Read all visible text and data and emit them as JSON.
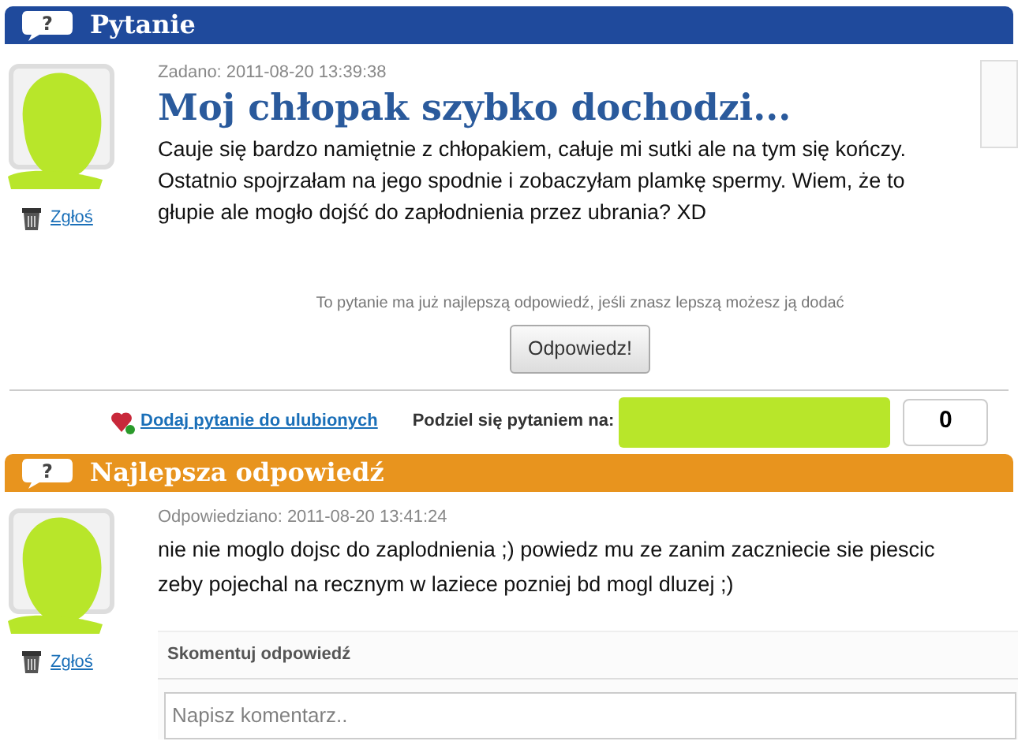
{
  "question": {
    "header_icon": "?",
    "header": "Pytanie",
    "asked": "Zadano: 2011-08-20 13:39:38",
    "title": "Moj chłopak szybko dochodzi...",
    "body": "Cauje się bardzo namiętnie z chłopakiem, całuje mi sutki ale na tym się kończy. Ostatnio spojrzałam na jego spodnie i zobaczyłam plamkę spermy. Wiem, że to głupie ale mogło dojść do zapłodnienia przez ubrania? XD",
    "report": "Zgłoś"
  },
  "notice": "To pytanie ma już najlepszą odpowiedź, jeśli znasz lepszą możesz ją dodać",
  "answer_button": "Odpowiedz!",
  "favorite_link": "Dodaj pytanie do ulubionych",
  "share_label": "Podziel się pytaniem na:",
  "share_count": "0",
  "best_answer": {
    "header_icon": "?",
    "header": "Najlepsza odpowiedź",
    "answered": "Odpowiedziano: 2011-08-20 13:41:24",
    "body": "nie nie moglo dojsc do zaplodnienia ;) powiedz mu ze zanim zaczniecie sie piescic zeby pojechal na recznym w laziece pozniej bd mogl dluzej ;)",
    "report": "Zgłoś"
  },
  "comment": {
    "heading": "Skomentuj odpowiedź",
    "placeholder": "Napisz komentarz.."
  }
}
